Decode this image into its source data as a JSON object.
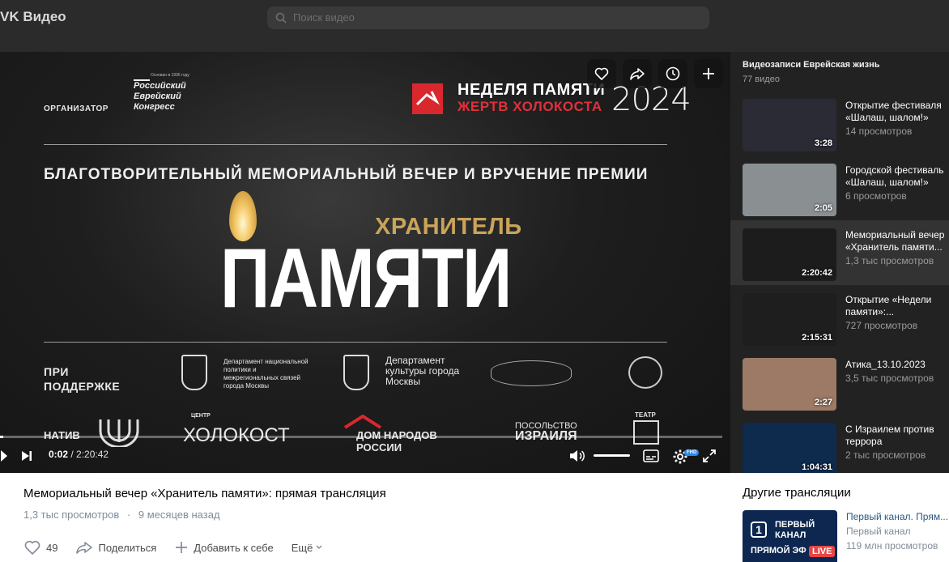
{
  "app": {
    "logo": "VK Видео",
    "search_placeholder": "Поиск видео"
  },
  "poster": {
    "organizer_label": "ОРГАНИЗАТОР",
    "rec_small": "Основан в 1996 году",
    "rec_line1": "Российский",
    "rec_line2": "Еврейский",
    "rec_line3": "Конгресс",
    "week_line1": "НЕДЕЛЯ ПАМЯТИ",
    "week_line2": "ЖЕРТВ ХОЛОКОСТА",
    "year": "2024",
    "subtitle": "БЛАГОТВОРИТЕЛЬНЫЙ МЕМОРИАЛЬНЫЙ ВЕЧЕР И ВРУЧЕНИЕ ПРЕМИИ",
    "keeper": "ХРАНИТЕЛЬ",
    "memory": "ПАМЯТИ",
    "support_line1": "ПРИ",
    "support_line2": "ПОДДЕРЖКЕ",
    "dept1": "Департамент национальной политики и межрегиональных связей города Москвы",
    "dept2": "Департамент культуры города Москвы",
    "logo_nativ": "НАТИВ",
    "logo_holocaust": "ХОЛОКОСТ",
    "logo_holocaust_small": "ЦЕНТР",
    "logo_dom1": "ДОМ НАРОДОВ",
    "logo_dom2": "РОССИИ",
    "logo_embassy_small": "ПОСОЛЬСТВО",
    "logo_embassy": "ИЗРАИЛЯ",
    "logo_theatre": "ТЕАТР"
  },
  "player": {
    "current_time": "0:02",
    "separator": " / ",
    "total_time": "2:20:42",
    "progress_fraction": 0.0002,
    "volume_fraction": 1.0,
    "hd_badge": "FHD"
  },
  "playlist": {
    "title": "Видеозаписи Еврейская жизнь",
    "count": "77 видео",
    "items": [
      {
        "title": "Открытие фестиваля «Шалаш, шалом!»",
        "views": "14 просмотров",
        "duration": "3:28",
        "thumb_color": "#2b2b35"
      },
      {
        "title": "Городской фестиваль «Шалаш, шалом!»",
        "views": "6 просмотров",
        "duration": "2:05",
        "thumb_color": "#8a8f92"
      },
      {
        "title": "Мемориальный вечер «Хранитель памяти...",
        "views": "1,3 тыс просмотров",
        "duration": "2:20:42",
        "thumb_color": "#1c1c1c",
        "active": true
      },
      {
        "title": "Открытие «Недели памяти»:...",
        "views": "727 просмотров",
        "duration": "2:15:31",
        "thumb_color": "#1e1e1e"
      },
      {
        "title": "Атика_13.10.2023",
        "views": "3,5 тыс просмотров",
        "duration": "2:27",
        "thumb_color": "#9c7a66"
      },
      {
        "title": "С Израилем против террора",
        "views": "2 тыс просмотров",
        "duration": "1:04:31",
        "thumb_color": "#0e2a4d"
      }
    ]
  },
  "video": {
    "title": "Мемориальный вечер «Хранитель памяти»: прямая трансляция",
    "views": "1,3 тыс просмотров",
    "dot": "·",
    "age": "9 месяцев назад",
    "likes": "49",
    "share_label": "Поделиться",
    "add_label": "Добавить к себе",
    "more_label": "Ещё"
  },
  "other": {
    "title": "Другие трансляции",
    "item": {
      "title": "Первый канал. Прям...",
      "channel": "Первый канал",
      "views": "119 млн просмотров",
      "thumb_line1": "ПЕРВЫЙ",
      "thumb_line2": "КАНАЛ",
      "thumb_line3": "ПРЯМОЙ ЭФ",
      "live": "LIVE"
    }
  },
  "colors": {
    "accent": "#2688eb",
    "live": "#e64646",
    "keeper_gold": "#c9a45a",
    "brand_red": "#d9272e"
  },
  "icons": [
    "search-icon",
    "heart-icon",
    "share-icon",
    "clock-icon",
    "plus-icon",
    "play-icon",
    "next-icon",
    "volume-icon",
    "subtitles-icon",
    "settings-icon",
    "fullscreen-icon",
    "chevron-down-icon"
  ]
}
